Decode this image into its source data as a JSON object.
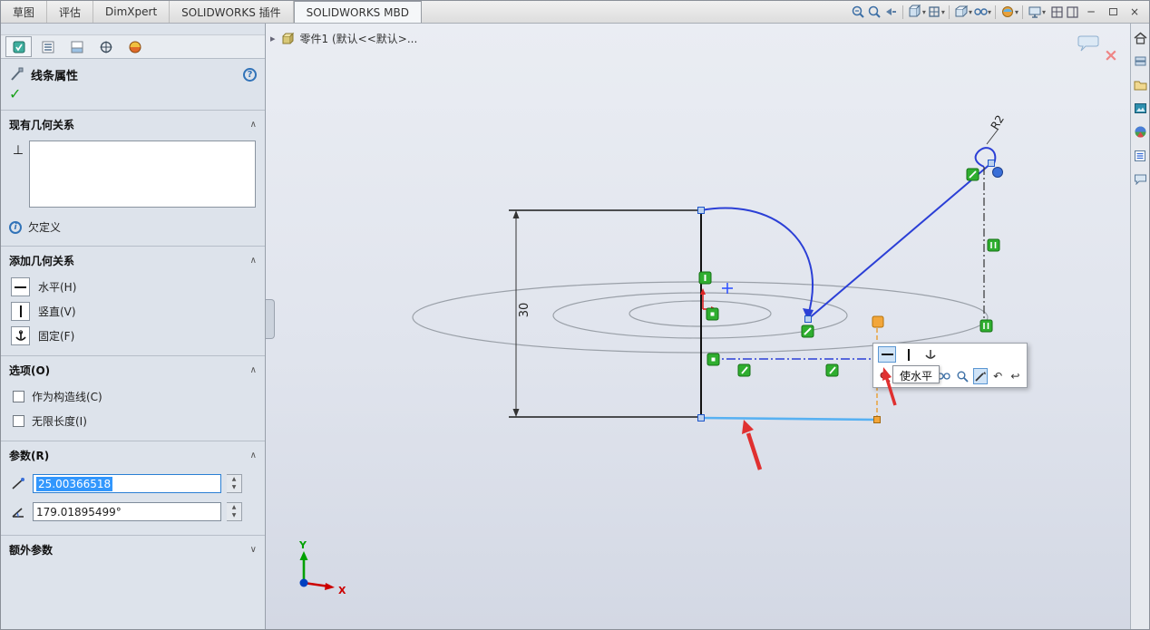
{
  "window": {
    "controls": {
      "minimize": "─",
      "close": "×"
    }
  },
  "menu": {
    "tabs": [
      {
        "label": "草图"
      },
      {
        "label": "评估"
      },
      {
        "label": "DimXpert"
      },
      {
        "label": "SOLIDWORKS 插件"
      },
      {
        "label": "SOLIDWORKS MBD"
      }
    ],
    "dropdown_glyph": "▾"
  },
  "property_manager": {
    "title": "线条属性",
    "help_glyph": "?",
    "accept_glyph": "✓",
    "chevron_up": "∧",
    "chevron_down": "∨",
    "existing_relations": {
      "header": "现有几何关系",
      "margin_icon_glyph": "⊥"
    },
    "status": {
      "icon_glyph": "i",
      "label": "欠定义"
    },
    "add_relations": {
      "header": "添加几何关系",
      "items": [
        {
          "label": "水平(H)"
        },
        {
          "label": "竖直(V)"
        },
        {
          "label": "固定(F)"
        }
      ]
    },
    "options": {
      "header": "选项(O)",
      "checkboxes": [
        {
          "label": "作为构造线(C)",
          "checked": false
        },
        {
          "label": "无限长度(I)",
          "checked": false
        }
      ]
    },
    "parameters": {
      "header": "参数(R)",
      "length_value": "25.00366518",
      "angle_value": "179.01895499°"
    },
    "extra_parameters": {
      "header": "额外参数"
    }
  },
  "viewport": {
    "feature_tree": {
      "expand_glyph": "▸",
      "label": "零件1 (默认<<默认>..."
    },
    "context_toolbar": {
      "tooltip": "使水平"
    },
    "close_tip_glyph": "×",
    "sketch": {
      "dimension_height": "30",
      "dimension_radius": "R2",
      "axis_x": "X",
      "axis_y": "Y"
    }
  },
  "colors": {
    "accent_blue": "#2b3fd6",
    "selected_line": "#57b1f2",
    "construction_orange": "#e8a13c",
    "relation_green": "#2fae2f",
    "annotation_red": "#e03030"
  }
}
